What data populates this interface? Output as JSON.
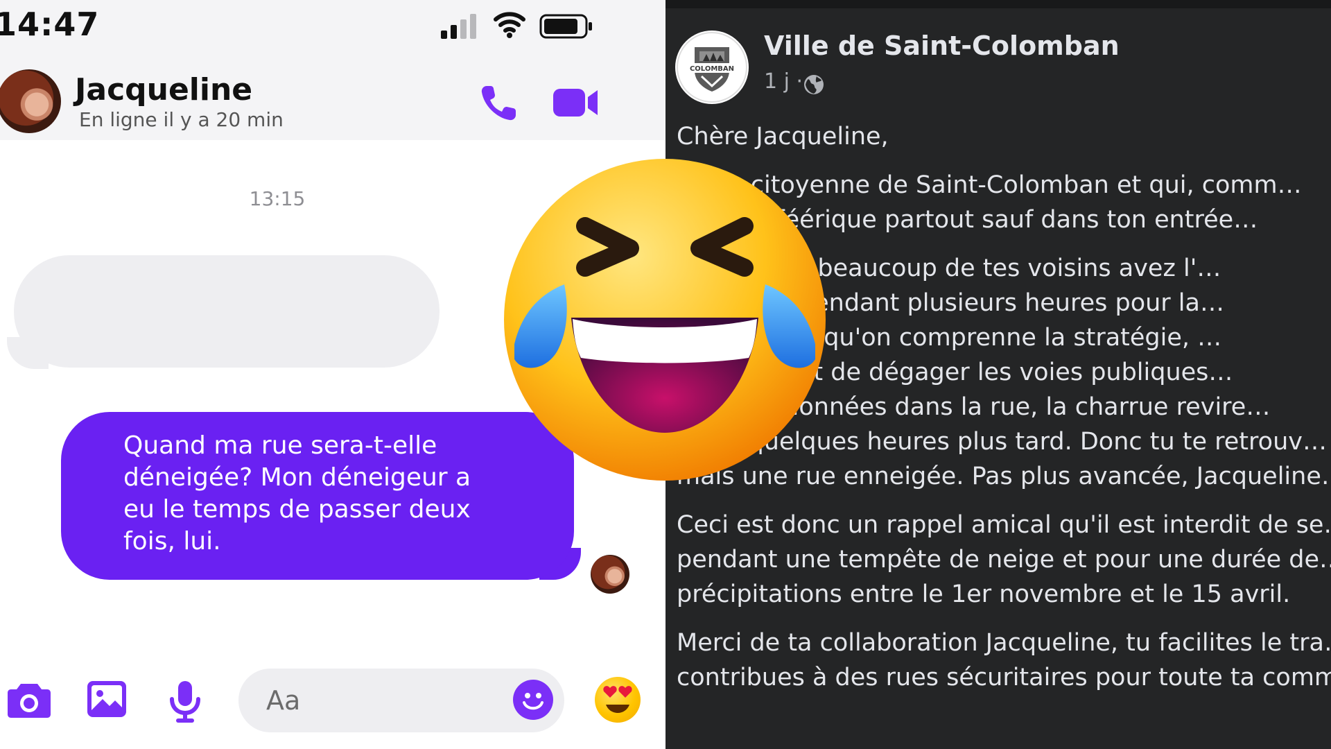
{
  "status_bar": {
    "time": "14:47"
  },
  "chat_header": {
    "contact_name": "Jacqueline",
    "contact_status": "En ligne il y a 20 min"
  },
  "conversation": {
    "timestamp": "13:15",
    "sent_message": "Quand ma rue sera-t-elle\ndéneigée? Mon déneigeur a\neu le temps de passer deux\nfois, lui."
  },
  "composer": {
    "placeholder": "Aa"
  },
  "icons": {
    "header": [
      "phone-icon",
      "video-camera-icon"
    ],
    "composer": [
      "camera-icon",
      "gallery-icon",
      "microphone-icon",
      "smiley-icon",
      "heart-eyes-emoji"
    ],
    "overlay": "laughing-crying-emoji"
  },
  "colors": {
    "accent_purple": "#6a21f2",
    "bubble_grey": "#eeeef1",
    "facebook_dark_bg": "#242526",
    "facebook_text": "#e4e6eb"
  },
  "post": {
    "page_name": "Ville de Saint-Colomban",
    "page_logo_text": "COLOMBAN",
    "meta": "1 j ·",
    "paragraphs": [
      "Chère Jacqueline,",
      "…i es citoyenne de Saint-Colomban et qui, comm…\n…neige féérique partout sauf dans ton entrée…",
      "…ge, toi et beaucoup de tes voisins avez l'…\n…s la rue pendant plusieurs heures pour la…\n…rivé. Bien qu'on comprenne la stratégie, …\n…s la rue et de dégager les voies publiques…\n…tos stationnées dans la rue, la charrue revire…\n…ent quelques heures plus tard. Donc tu te retrouv…\nmais une rue enneigée. Pas plus avancée, Jacqueline…",
      "Ceci est donc un rappel amical qu'il est interdit de se…\npendant une tempête de neige et pour une durée de…\nprécipitations entre le 1er novembre et le 15 avril.",
      "Merci de ta collaboration Jacqueline, tu facilites le tra…\ncontribues à des rues sécuritaires pour toute ta comm…"
    ]
  }
}
